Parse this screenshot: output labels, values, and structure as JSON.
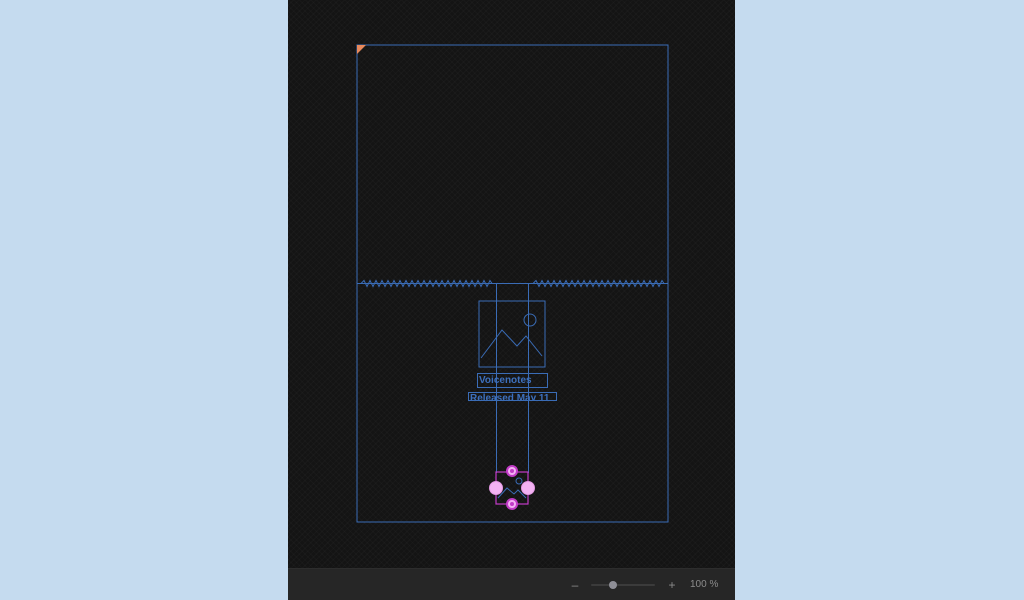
{
  "artboard": {
    "title_text": "Voicenotes",
    "subtitle_text": "Released May 11"
  },
  "zoom": {
    "minus_label": "–",
    "plus_label": "+",
    "value_text": "100 %",
    "level_fraction": 0.35
  },
  "colors": {
    "background": "#c5dbef",
    "canvas": "#141414",
    "blueprint_line": "#3a6cb6",
    "selection": "#c23bc7",
    "handle_fill": "#f3b2f3",
    "corner_marker": "#e8895c",
    "toolbar": "#262626"
  },
  "icons": {
    "image_placeholder": "image-placeholder-icon",
    "corner_marker": "corner-marker-icon"
  }
}
